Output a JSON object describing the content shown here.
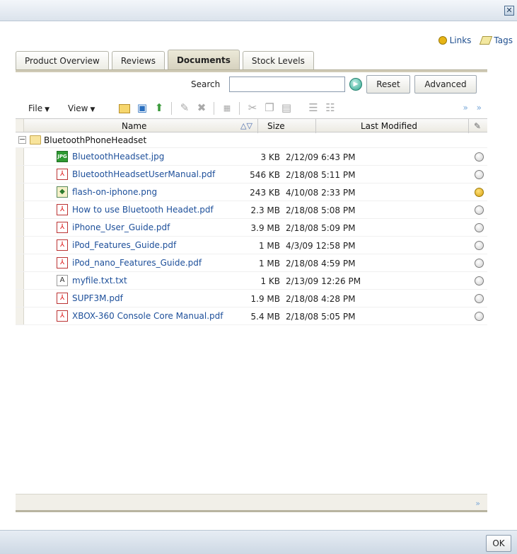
{
  "window": {
    "close_label": "✕"
  },
  "top_links": [
    {
      "label": "Links",
      "icon": "links-icon"
    },
    {
      "label": "Tags",
      "icon": "tag-icon"
    }
  ],
  "tabs": [
    {
      "label": "Product Overview",
      "active": false
    },
    {
      "label": "Reviews",
      "active": false
    },
    {
      "label": "Documents",
      "active": true
    },
    {
      "label": "Stock Levels",
      "active": false
    }
  ],
  "search": {
    "label": "Search",
    "value": "",
    "placeholder": "",
    "reset_label": "Reset",
    "advanced_label": "Advanced"
  },
  "toolbar": {
    "file_menu": "File",
    "view_menu": "View",
    "overflow": "» »"
  },
  "table": {
    "columns": [
      "Name",
      "Size",
      "Last Modified"
    ],
    "folder": "BluetoothPhoneHeadset",
    "rows": [
      {
        "name": "BluetoothHeadset.jpg",
        "size": "3 KB",
        "modified": "2/12/09 6:43 PM",
        "type": "jpg",
        "linked": false
      },
      {
        "name": "BluetoothHeadsetUserManual.pdf",
        "size": "546 KB",
        "modified": "2/18/08 5:11 PM",
        "type": "pdf",
        "linked": false
      },
      {
        "name": "flash-on-iphone.png",
        "size": "243 KB",
        "modified": "4/10/08 2:33 PM",
        "type": "png",
        "linked": true
      },
      {
        "name": "How to use Bluetooth Headet.pdf",
        "size": "2.3 MB",
        "modified": "2/18/08 5:08 PM",
        "type": "pdf",
        "linked": false
      },
      {
        "name": "iPhone_User_Guide.pdf",
        "size": "3.9 MB",
        "modified": "2/18/08 5:09 PM",
        "type": "pdf",
        "linked": false
      },
      {
        "name": "iPod_Features_Guide.pdf",
        "size": "1 MB",
        "modified": "4/3/09 12:58 PM",
        "type": "pdf",
        "linked": false
      },
      {
        "name": "iPod_nano_Features_Guide.pdf",
        "size": "1 MB",
        "modified": "2/18/08 4:59 PM",
        "type": "pdf",
        "linked": false
      },
      {
        "name": "myfile.txt.txt",
        "size": "1 KB",
        "modified": "2/13/09 12:26 PM",
        "type": "txt",
        "linked": false
      },
      {
        "name": "SUPF3M.pdf",
        "size": "1.9 MB",
        "modified": "2/18/08 4:28 PM",
        "type": "pdf",
        "linked": false
      },
      {
        "name": "XBOX-360 Console Core Manual.pdf",
        "size": "5.4 MB",
        "modified": "2/18/08 5:05 PM",
        "type": "pdf",
        "linked": false
      }
    ]
  },
  "bottom": {
    "overflow": "»"
  },
  "footer": {
    "ok_label": "OK"
  }
}
